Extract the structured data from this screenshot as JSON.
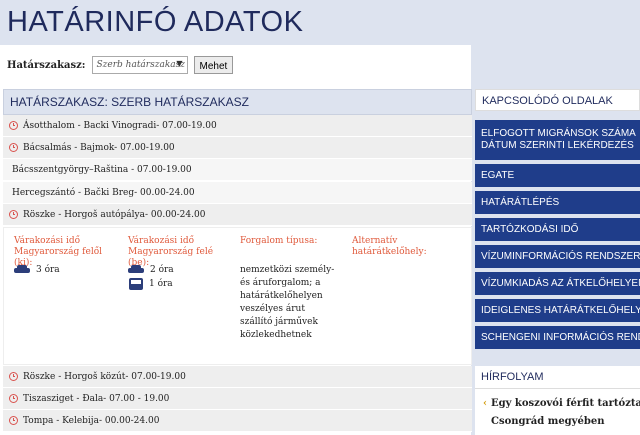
{
  "page": {
    "title": "HATÁRINFÓ ADATOK"
  },
  "filter": {
    "label": "Határszakasz:",
    "selected": "Szerb határszakasz",
    "button": "Mehet"
  },
  "section": {
    "title": "HATÁRSZAKASZ: SZERB HATÁRSZAKASZ"
  },
  "crossings": [
    {
      "label": "Ásotthalom - Backi Vinogradi- 07.00-19.00"
    },
    {
      "label": "Bácsalmás - Bajmok- 07.00-19.00"
    },
    {
      "label": "Bácsszentgyörgy–Raština - 07.00-19.00"
    },
    {
      "label": "Hercegszántó - Bački Breg- 00.00-24.00"
    },
    {
      "label": "Röszke - Horgoš autópálya- 00.00-24.00"
    },
    {
      "label": "Röszke - Horgoš közút- 07.00-19.00"
    },
    {
      "label": "Tiszasziget - Đala- 07.00 - 19.00"
    },
    {
      "label": "Tompa - Kelebija- 00.00-24.00"
    }
  ],
  "detail": {
    "col1_head": "Várakozási idő Magyarország felől (ki):",
    "col2_head": "Várakozási idő Magyarország felé (be):",
    "col3_head": "Forgalom típusa:",
    "col4_head": "Alternatív határátkelőhely:",
    "out_car": "3 óra",
    "in_car": "2 óra",
    "in_bus": "1 óra",
    "traffic": "nemzetközi személy- és áruforgalom; a határátkelőhelyen veszélyes árut szállító járművek közlekedhetnek"
  },
  "related": {
    "title": "KAPCSOLÓDÓ OLDALAK",
    "links": [
      {
        "line1": "ELFOGOTT MIGRÁNSOK SZÁMA",
        "line2": "DÁTUM SZERINTI LEKÉRDEZÉS"
      },
      {
        "line1": "EGATE"
      },
      {
        "line1": "HATÁRÁTLÉPÉS"
      },
      {
        "line1": "TARTÓZKODÁSI IDŐ"
      },
      {
        "line1": "VÍZUMINFORMÁCIÓS RENDSZER"
      },
      {
        "line1": "VÍZUMKIADÁS AZ ÁTKELŐHELYEN"
      },
      {
        "line1": "IDEIGLENES HATÁRÁTKELŐHELY"
      },
      {
        "line1": "SCHENGENI INFORMÁCIÓS RENDSZER"
      }
    ]
  },
  "news": {
    "title": "HÍRFOLYAM",
    "item_line1": "Egy koszovói férfit tartóztattak",
    "item_line2": "Csongrád megyében"
  },
  "colors": {
    "accent": "#1f3d8a",
    "banner": "#dde3ef",
    "label_red": "#e05a3c"
  }
}
